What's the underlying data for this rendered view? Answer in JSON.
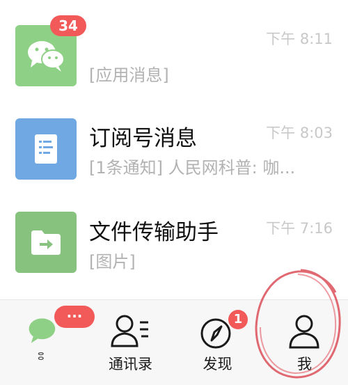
{
  "chats": [
    {
      "title": "",
      "preview": "[应用消息]",
      "time": "下午 8:11",
      "badge": "34",
      "avatar_icon": "wechat-icon",
      "avatar_color": "#8ed085"
    },
    {
      "title": "订阅号消息",
      "preview": "[1条通知] 人民网科普: 咖...",
      "time": "下午 8:03",
      "avatar_icon": "document-icon",
      "avatar_color": "#6fa8e3"
    },
    {
      "title": "文件传输助手",
      "preview": "[图片]",
      "time": "下午 7:16",
      "avatar_icon": "folder-transfer-icon",
      "avatar_color": "#87c27f"
    }
  ],
  "tabbar": {
    "tabs": [
      {
        "label": "",
        "icon": "chats-icon",
        "badge": "···"
      },
      {
        "label": "通讯录",
        "icon": "contacts-icon"
      },
      {
        "label": "发现",
        "icon": "compass-icon",
        "badge": "1"
      },
      {
        "label": "我",
        "icon": "person-icon"
      }
    ]
  },
  "colors": {
    "accent_green": "#8ed085",
    "badge_red": "#f25a5a",
    "annotation_red": "#d9434f"
  }
}
